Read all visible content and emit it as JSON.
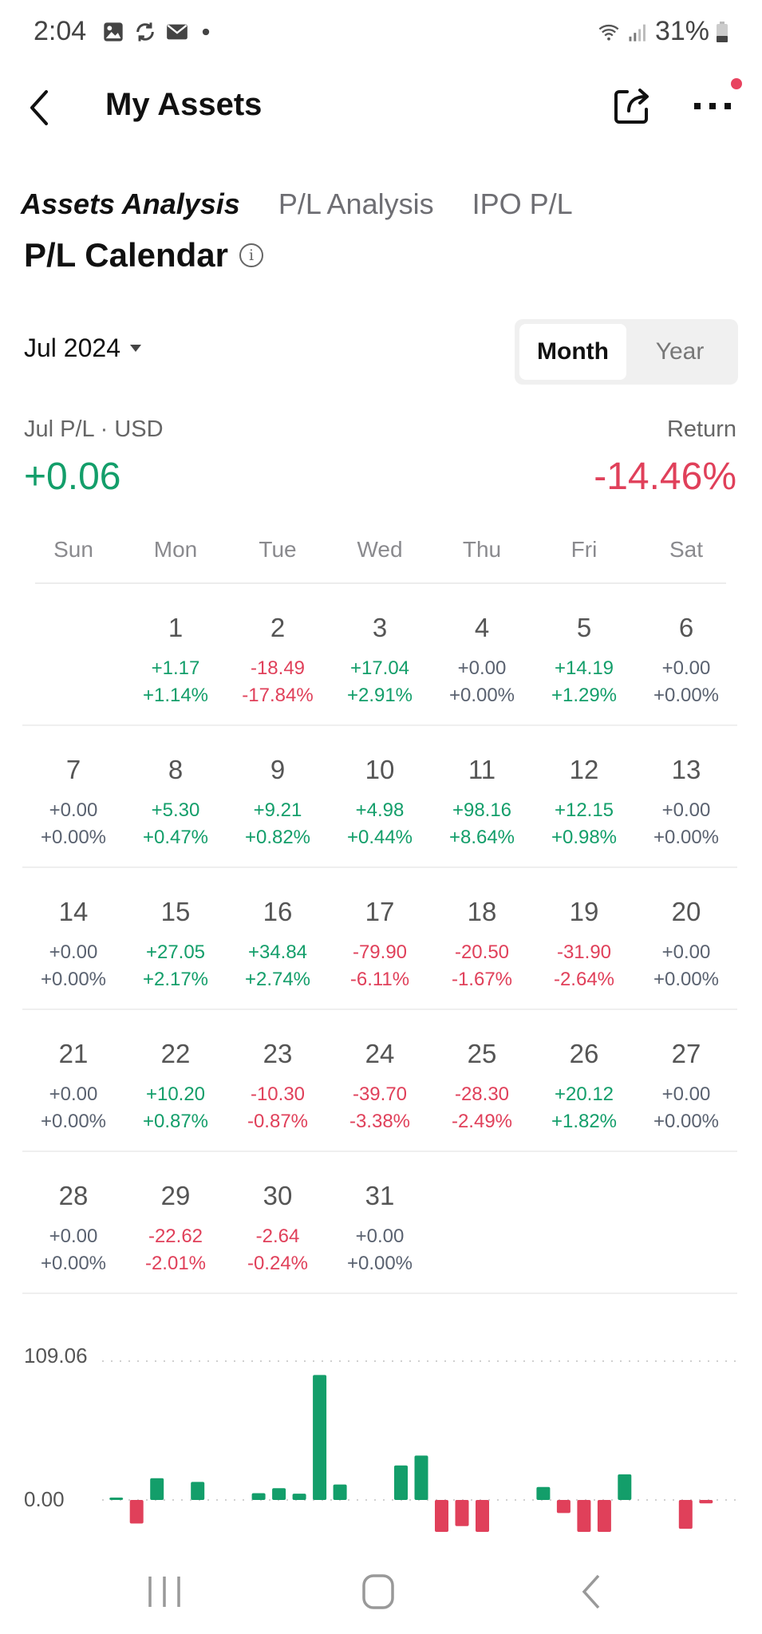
{
  "status_bar": {
    "time": "2:04",
    "left_icons": [
      "gallery-icon",
      "sync-icon",
      "mail-icon",
      "dot-icon"
    ],
    "right_icons": [
      "wifi-icon",
      "signal-icon",
      "battery-icon"
    ],
    "battery": "31%"
  },
  "header": {
    "title": "My Assets",
    "back_icon": "back-chevron-icon",
    "share_icon": "share-icon",
    "more_icon": "more-icon",
    "notification_dot_color": "#e8435f"
  },
  "tabs": [
    {
      "label": "Assets Analysis",
      "active": true
    },
    {
      "label": "P/L Analysis",
      "active": false
    },
    {
      "label": "IPO P/L",
      "active": false
    }
  ],
  "section": {
    "title": "P/L Calendar",
    "info_glyph": "i"
  },
  "controls": {
    "month_label": "Jul 2024",
    "segments": [
      {
        "label": "Month",
        "active": true
      },
      {
        "label": "Year",
        "active": false
      }
    ]
  },
  "summary": {
    "pl_label": "Jul P/L · USD",
    "pl_value": "+0.06",
    "return_label": "Return",
    "return_value": "-14.46%"
  },
  "colors": {
    "positive": "#139e6a",
    "negative": "#e0405a",
    "neutral": "#5a6270",
    "accent": "#f07020"
  },
  "calendar": {
    "weekdays": [
      "Sun",
      "Mon",
      "Tue",
      "Wed",
      "Thu",
      "Fri",
      "Sat"
    ],
    "start_offset": 1,
    "days": [
      {
        "day": "1",
        "amount": "+1.17",
        "pct": "+1.14%",
        "sign": "pos"
      },
      {
        "day": "2",
        "amount": "-18.49",
        "pct": "-17.84%",
        "sign": "neg"
      },
      {
        "day": "3",
        "amount": "+17.04",
        "pct": "+2.91%",
        "sign": "pos"
      },
      {
        "day": "4",
        "amount": "+0.00",
        "pct": "+0.00%",
        "sign": "zero"
      },
      {
        "day": "5",
        "amount": "+14.19",
        "pct": "+1.29%",
        "sign": "pos"
      },
      {
        "day": "6",
        "amount": "+0.00",
        "pct": "+0.00%",
        "sign": "zero"
      },
      {
        "day": "7",
        "amount": "+0.00",
        "pct": "+0.00%",
        "sign": "zero"
      },
      {
        "day": "8",
        "amount": "+5.30",
        "pct": "+0.47%",
        "sign": "pos"
      },
      {
        "day": "9",
        "amount": "+9.21",
        "pct": "+0.82%",
        "sign": "pos"
      },
      {
        "day": "10",
        "amount": "+4.98",
        "pct": "+0.44%",
        "sign": "pos"
      },
      {
        "day": "11",
        "amount": "+98.16",
        "pct": "+8.64%",
        "sign": "pos"
      },
      {
        "day": "12",
        "amount": "+12.15",
        "pct": "+0.98%",
        "sign": "pos"
      },
      {
        "day": "13",
        "amount": "+0.00",
        "pct": "+0.00%",
        "sign": "zero"
      },
      {
        "day": "14",
        "amount": "+0.00",
        "pct": "+0.00%",
        "sign": "zero"
      },
      {
        "day": "15",
        "amount": "+27.05",
        "pct": "+2.17%",
        "sign": "pos"
      },
      {
        "day": "16",
        "amount": "+34.84",
        "pct": "+2.74%",
        "sign": "pos"
      },
      {
        "day": "17",
        "amount": "-79.90",
        "pct": "-6.11%",
        "sign": "neg"
      },
      {
        "day": "18",
        "amount": "-20.50",
        "pct": "-1.67%",
        "sign": "neg"
      },
      {
        "day": "19",
        "amount": "-31.90",
        "pct": "-2.64%",
        "sign": "neg"
      },
      {
        "day": "20",
        "amount": "+0.00",
        "pct": "+0.00%",
        "sign": "zero"
      },
      {
        "day": "21",
        "amount": "+0.00",
        "pct": "+0.00%",
        "sign": "zero"
      },
      {
        "day": "22",
        "amount": "+10.20",
        "pct": "+0.87%",
        "sign": "pos"
      },
      {
        "day": "23",
        "amount": "-10.30",
        "pct": "-0.87%",
        "sign": "neg"
      },
      {
        "day": "24",
        "amount": "-39.70",
        "pct": "-3.38%",
        "sign": "neg"
      },
      {
        "day": "25",
        "amount": "-28.30",
        "pct": "-2.49%",
        "sign": "neg"
      },
      {
        "day": "26",
        "amount": "+20.12",
        "pct": "+1.82%",
        "sign": "pos"
      },
      {
        "day": "27",
        "amount": "+0.00",
        "pct": "+0.00%",
        "sign": "zero"
      },
      {
        "day": "28",
        "amount": "+0.00",
        "pct": "+0.00%",
        "sign": "zero"
      },
      {
        "day": "29",
        "amount": "-22.62",
        "pct": "-2.01%",
        "sign": "neg"
      },
      {
        "day": "30",
        "amount": "-2.64",
        "pct": "-0.24%",
        "sign": "neg"
      },
      {
        "day": "31",
        "amount": "+0.00",
        "pct": "+0.00%",
        "sign": "zero"
      }
    ]
  },
  "chart_data": {
    "type": "bar",
    "title": "",
    "xlabel": "",
    "ylabel": "",
    "y_tick_labels": [
      "109.06",
      "0.00"
    ],
    "ylim_top": 109.06,
    "grid": "dotted",
    "categories": [
      "b1",
      "b2",
      "b3",
      "b4",
      "b5",
      "b6",
      "b7",
      "b8",
      "b9",
      "b10",
      "b11",
      "b12",
      "b13",
      "b14",
      "b15",
      "b16",
      "b17",
      "b18",
      "b19",
      "b20",
      "b21",
      "b22",
      "b23",
      "b24",
      "b25",
      "b26",
      "b27",
      "b28",
      "b29",
      "b30",
      "b31"
    ],
    "values": [
      1.17,
      -18.49,
      17.04,
      0,
      14.19,
      0,
      0,
      5.3,
      9.21,
      4.98,
      98.16,
      12.15,
      0,
      0,
      27.05,
      34.84,
      -79.9,
      -20.5,
      -31.9,
      0,
      0,
      10.2,
      -10.3,
      -39.7,
      -28.3,
      20.12,
      0,
      0,
      -22.62,
      -2.64,
      0
    ],
    "note": "Bars ordered by day of July; negative bars clipped at chart bottom"
  },
  "nav_bar": {
    "buttons": [
      "recents-icon",
      "home-icon",
      "back-icon"
    ]
  }
}
